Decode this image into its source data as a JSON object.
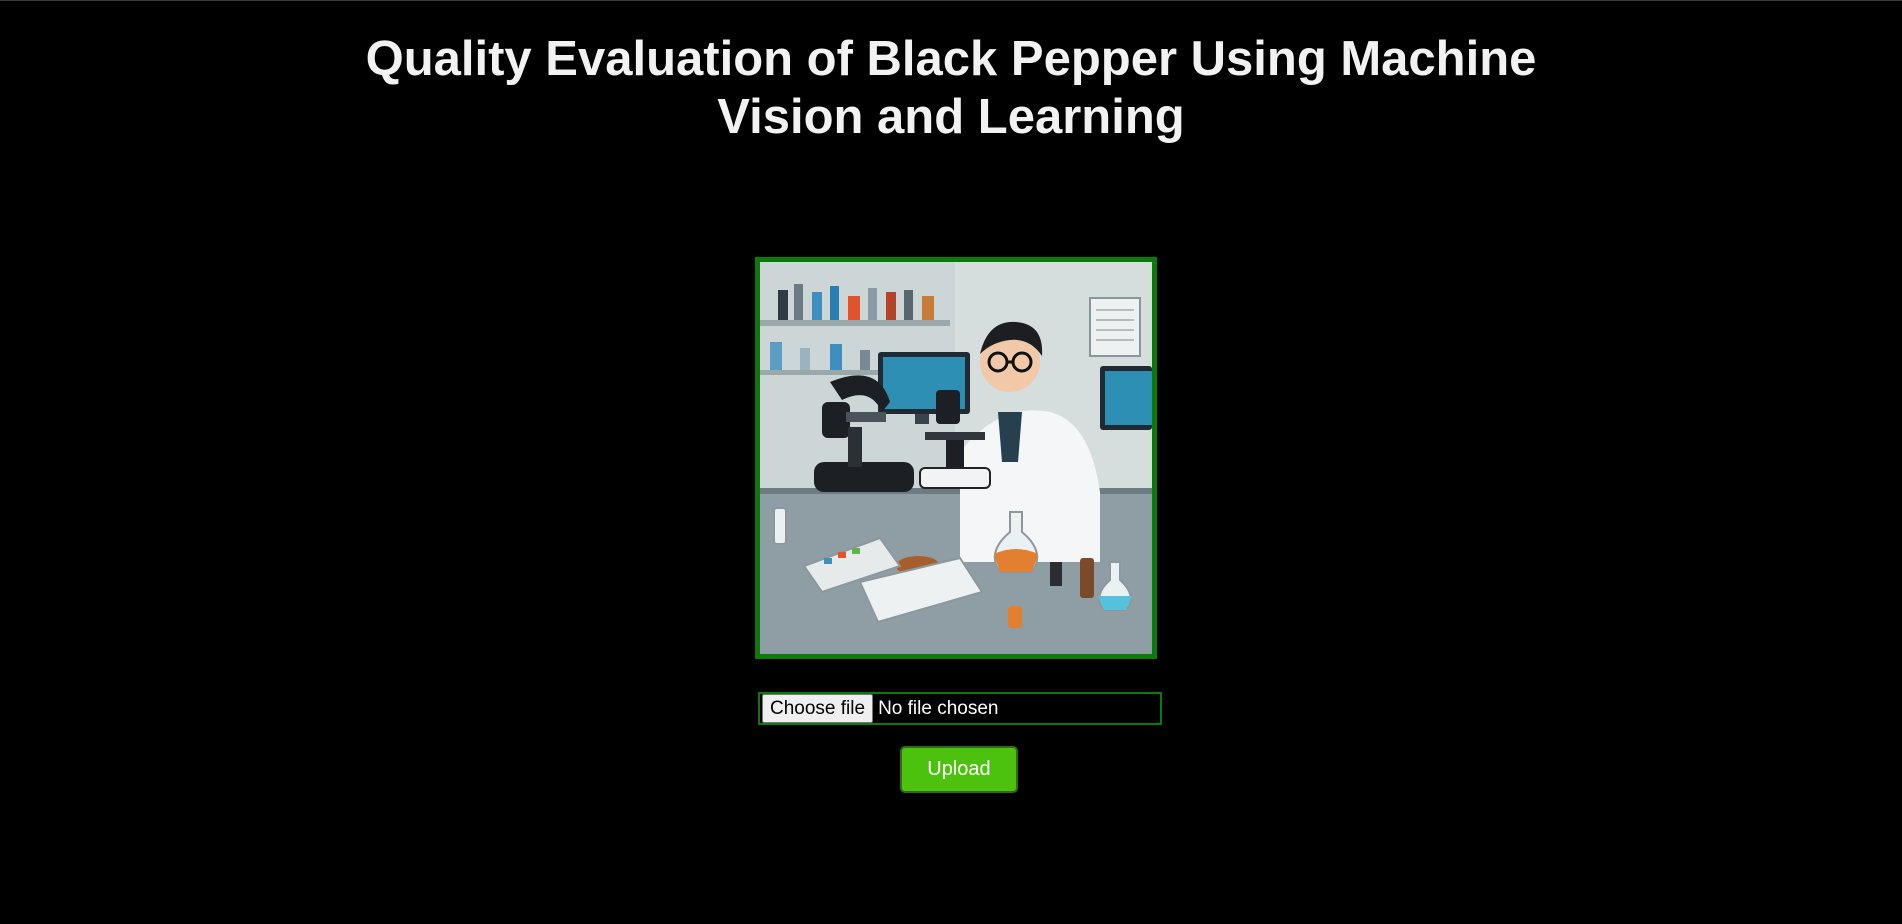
{
  "header": {
    "title": "Quality Evaluation of Black Pepper Using Machine Vision and Learning"
  },
  "hero": {
    "icon": "lab-scientist-microscope-illustration"
  },
  "upload_form": {
    "choose_file_label": "Choose file",
    "file_status": "No file chosen",
    "upload_label": "Upload"
  },
  "colors": {
    "background": "#000000",
    "accent_border": "#0b7a0b",
    "upload_button": "#4cc20e",
    "title_text": "#f2f2f2"
  }
}
